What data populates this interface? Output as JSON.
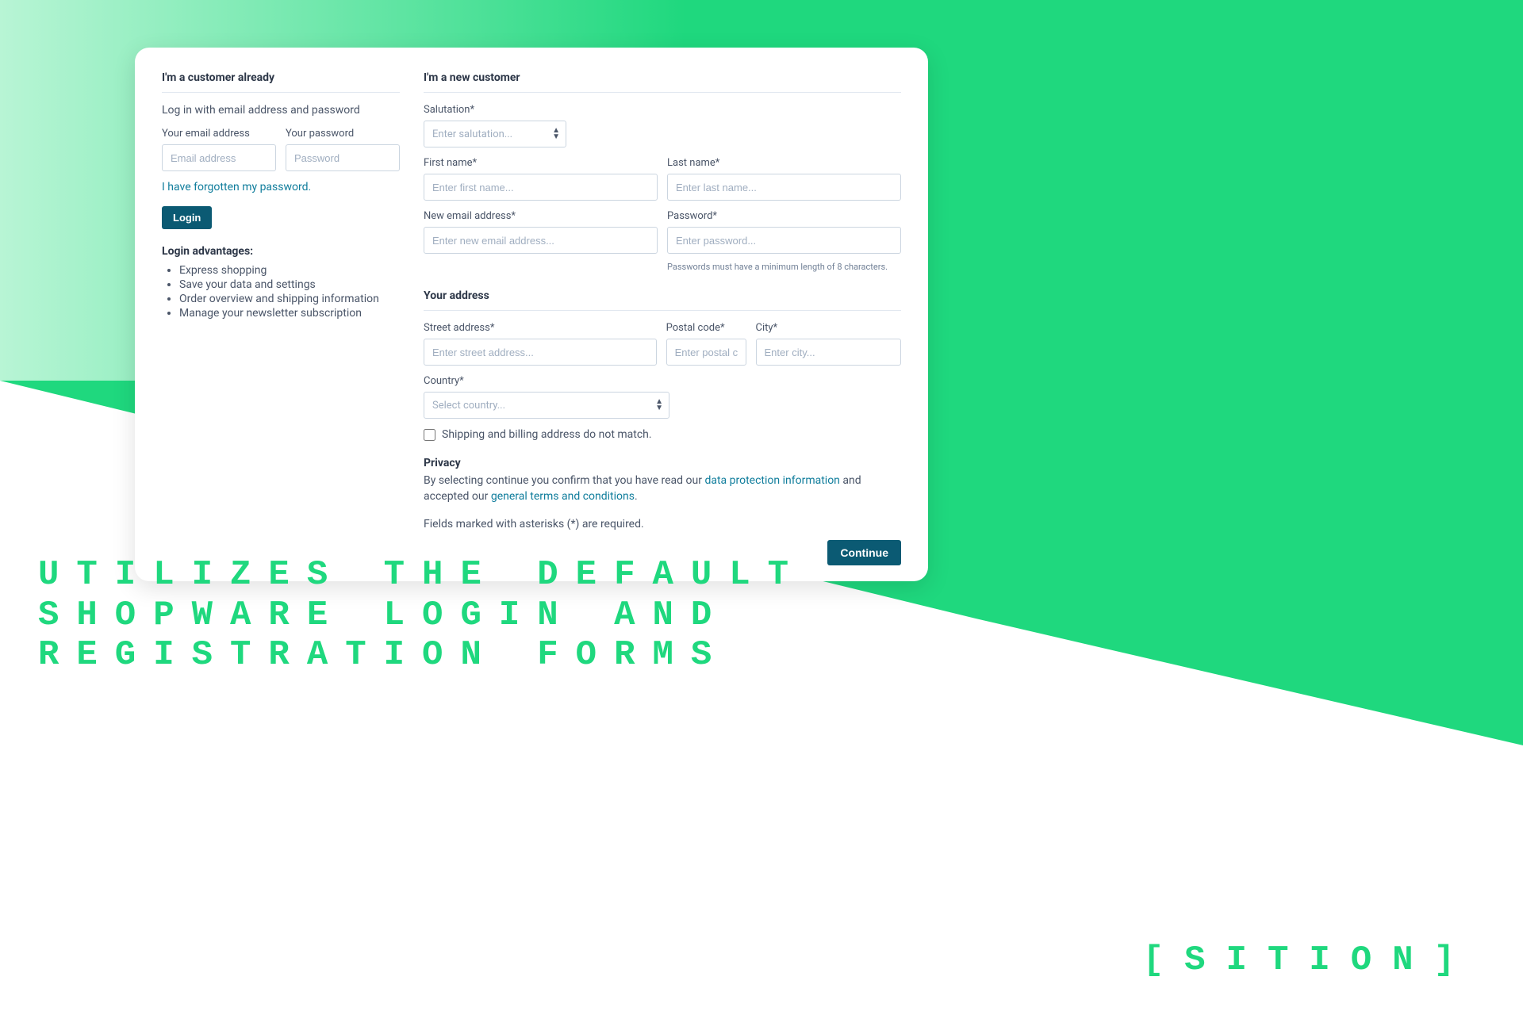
{
  "login": {
    "title": "I'm a customer already",
    "instruction": "Log in with email address and password",
    "email_label": "Your email address",
    "email_placeholder": "Email address",
    "password_label": "Your password",
    "password_placeholder": "Password",
    "forgot_link": "I have forgotten my password.",
    "button": "Login",
    "advantages_title": "Login advantages:",
    "advantages": [
      "Express shopping",
      "Save your data and settings",
      "Order overview and shipping information",
      "Manage your newsletter subscription"
    ]
  },
  "register": {
    "title": "I'm a new customer",
    "salutation_label": "Salutation*",
    "salutation_placeholder": "Enter salutation...",
    "first_name_label": "First name*",
    "first_name_placeholder": "Enter first name...",
    "last_name_label": "Last name*",
    "last_name_placeholder": "Enter last name...",
    "email_label": "New email address*",
    "email_placeholder": "Enter new email address...",
    "password_label": "Password*",
    "password_placeholder": "Enter password...",
    "password_hint": "Passwords must have a minimum length of 8 characters.",
    "address_title": "Your address",
    "street_label": "Street address*",
    "street_placeholder": "Enter street address...",
    "postal_label": "Postal code*",
    "postal_placeholder": "Enter postal code.",
    "city_label": "City*",
    "city_placeholder": "Enter city...",
    "country_label": "Country*",
    "country_placeholder": "Select country...",
    "diff_address_label": "Shipping and billing address do not match.",
    "privacy_title": "Privacy",
    "privacy_prefix": "By selecting continue you confirm that you have read our ",
    "privacy_link1": "data protection information",
    "privacy_mid": " and accepted our ",
    "privacy_link2": "general terms and conditions",
    "privacy_suffix": ".",
    "required_note": "Fields marked with asterisks (*) are required.",
    "continue_button": "Continue"
  },
  "caption": "UTILIZES THE DEFAULT\nSHOPWARE LOGIN AND\nREGISTRATION FORMS",
  "logo": {
    "open": "[",
    "text": "SITION",
    "close": "]"
  }
}
